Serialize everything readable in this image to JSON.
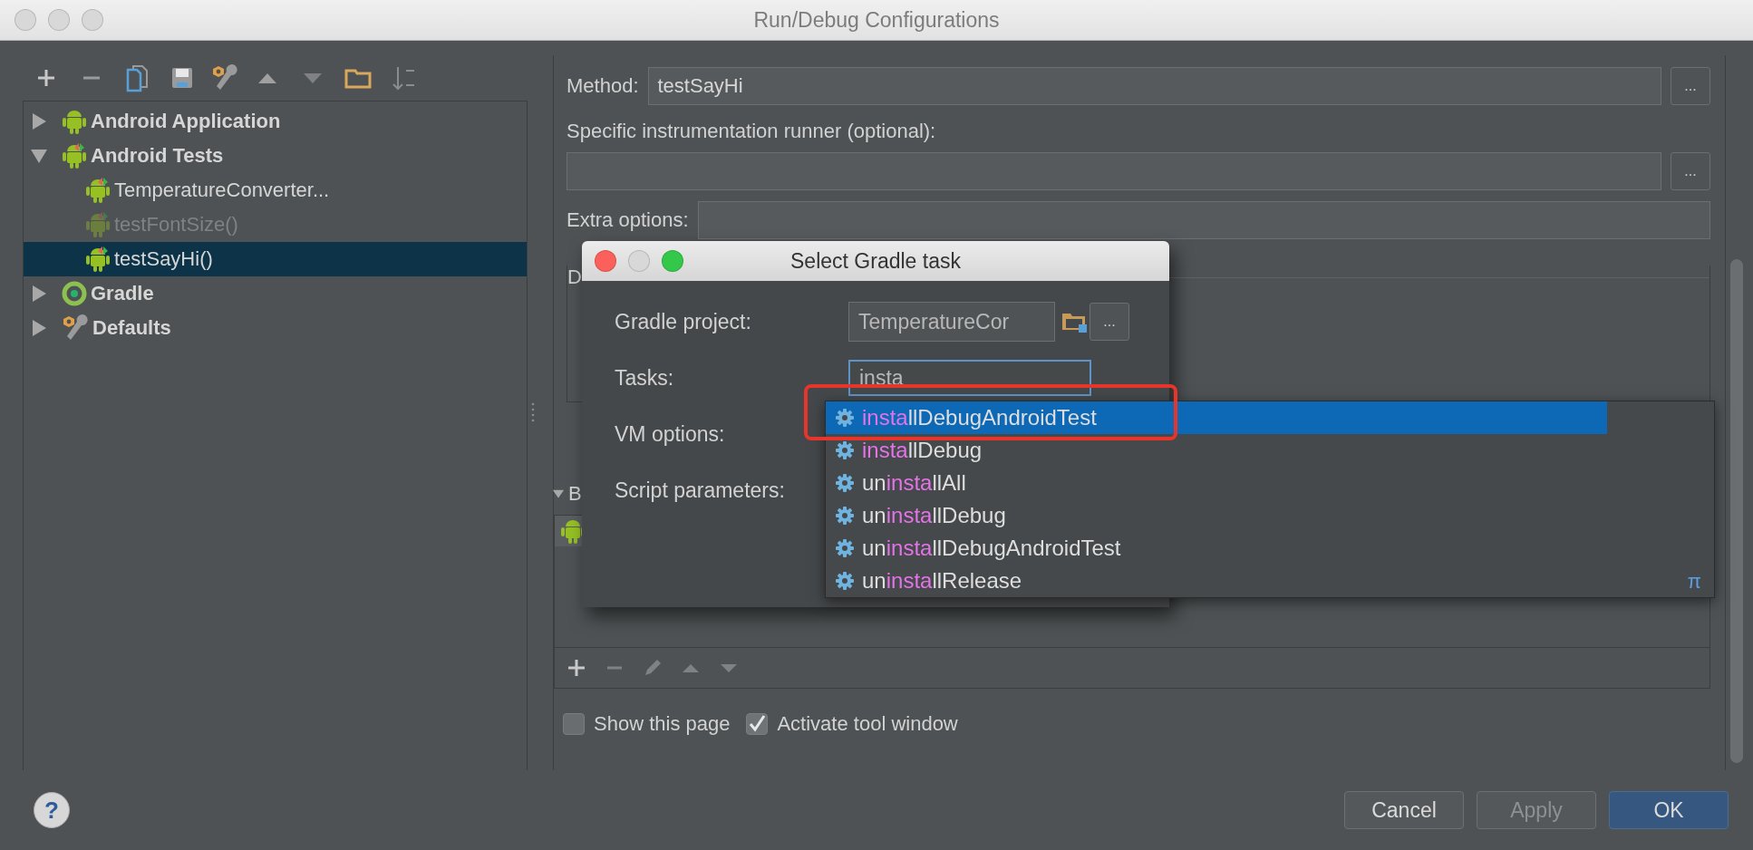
{
  "window": {
    "title": "Run/Debug Configurations"
  },
  "tree": [
    {
      "label": "Android Application",
      "kind": "android",
      "expanded": false,
      "selected": false
    },
    {
      "label": "Android Tests",
      "kind": "android-test",
      "expanded": true,
      "selected": false,
      "children": [
        {
          "label": "TemperatureConverter...",
          "kind": "android-test",
          "disabled": false,
          "selected": false
        },
        {
          "label": "testFontSize()",
          "kind": "android-test",
          "disabled": true,
          "selected": false
        },
        {
          "label": "testSayHi()",
          "kind": "android-test",
          "disabled": false,
          "selected": true
        }
      ]
    },
    {
      "label": "Gradle",
      "kind": "gradle",
      "expanded": false,
      "selected": false
    },
    {
      "label": "Defaults",
      "kind": "defaults",
      "expanded": false,
      "selected": false
    }
  ],
  "form": {
    "method": {
      "label": "Method:",
      "value": "testSayHi",
      "button": "..."
    },
    "runner": {
      "label": "Specific instrumentation runner (optional):",
      "button": "..."
    },
    "extra_options": {
      "label": "Extra options:"
    },
    "group_1": {
      "title": "D"
    },
    "group_2": {
      "title": "B",
      "expanded": true,
      "rows": [
        {
          "kind": "android",
          "selected": true
        }
      ]
    }
  },
  "checkboxes": [
    {
      "label": "Show this page",
      "checked": false
    },
    {
      "label": "Activate tool window",
      "checked": true
    }
  ],
  "help": "?",
  "buttons": [
    {
      "label": "Cancel",
      "kind": "normal"
    },
    {
      "label": "Apply",
      "kind": "disabled"
    },
    {
      "label": "OK",
      "kind": "default"
    }
  ],
  "dialog": {
    "title": "Select Gradle task",
    "fields": [
      {
        "label": "Gradle project:",
        "kind": "project",
        "value": "TemperatureCor",
        "button": "..."
      },
      {
        "label": "Tasks:",
        "kind": "tasks",
        "value": "insta"
      },
      {
        "label": "VM options:",
        "kind": "hidden"
      },
      {
        "label": "Script parameters:",
        "kind": "hidden"
      }
    ]
  },
  "popup": {
    "items": [
      {
        "match": "insta",
        "rest": "llDebugAndroidTest",
        "selected": true
      },
      {
        "match": "insta",
        "rest": "llDebug",
        "selected": false
      },
      {
        "prefix": "un",
        "match": "insta",
        "rest": "llAll",
        "selected": false
      },
      {
        "prefix": "un",
        "match": "insta",
        "rest": "llDebug",
        "selected": false
      },
      {
        "prefix": "un",
        "match": "insta",
        "rest": "llDebugAndroidTest",
        "selected": false
      },
      {
        "prefix": "un",
        "match": "insta",
        "rest": "llRelease",
        "selected": false
      }
    ],
    "corner": "π"
  }
}
